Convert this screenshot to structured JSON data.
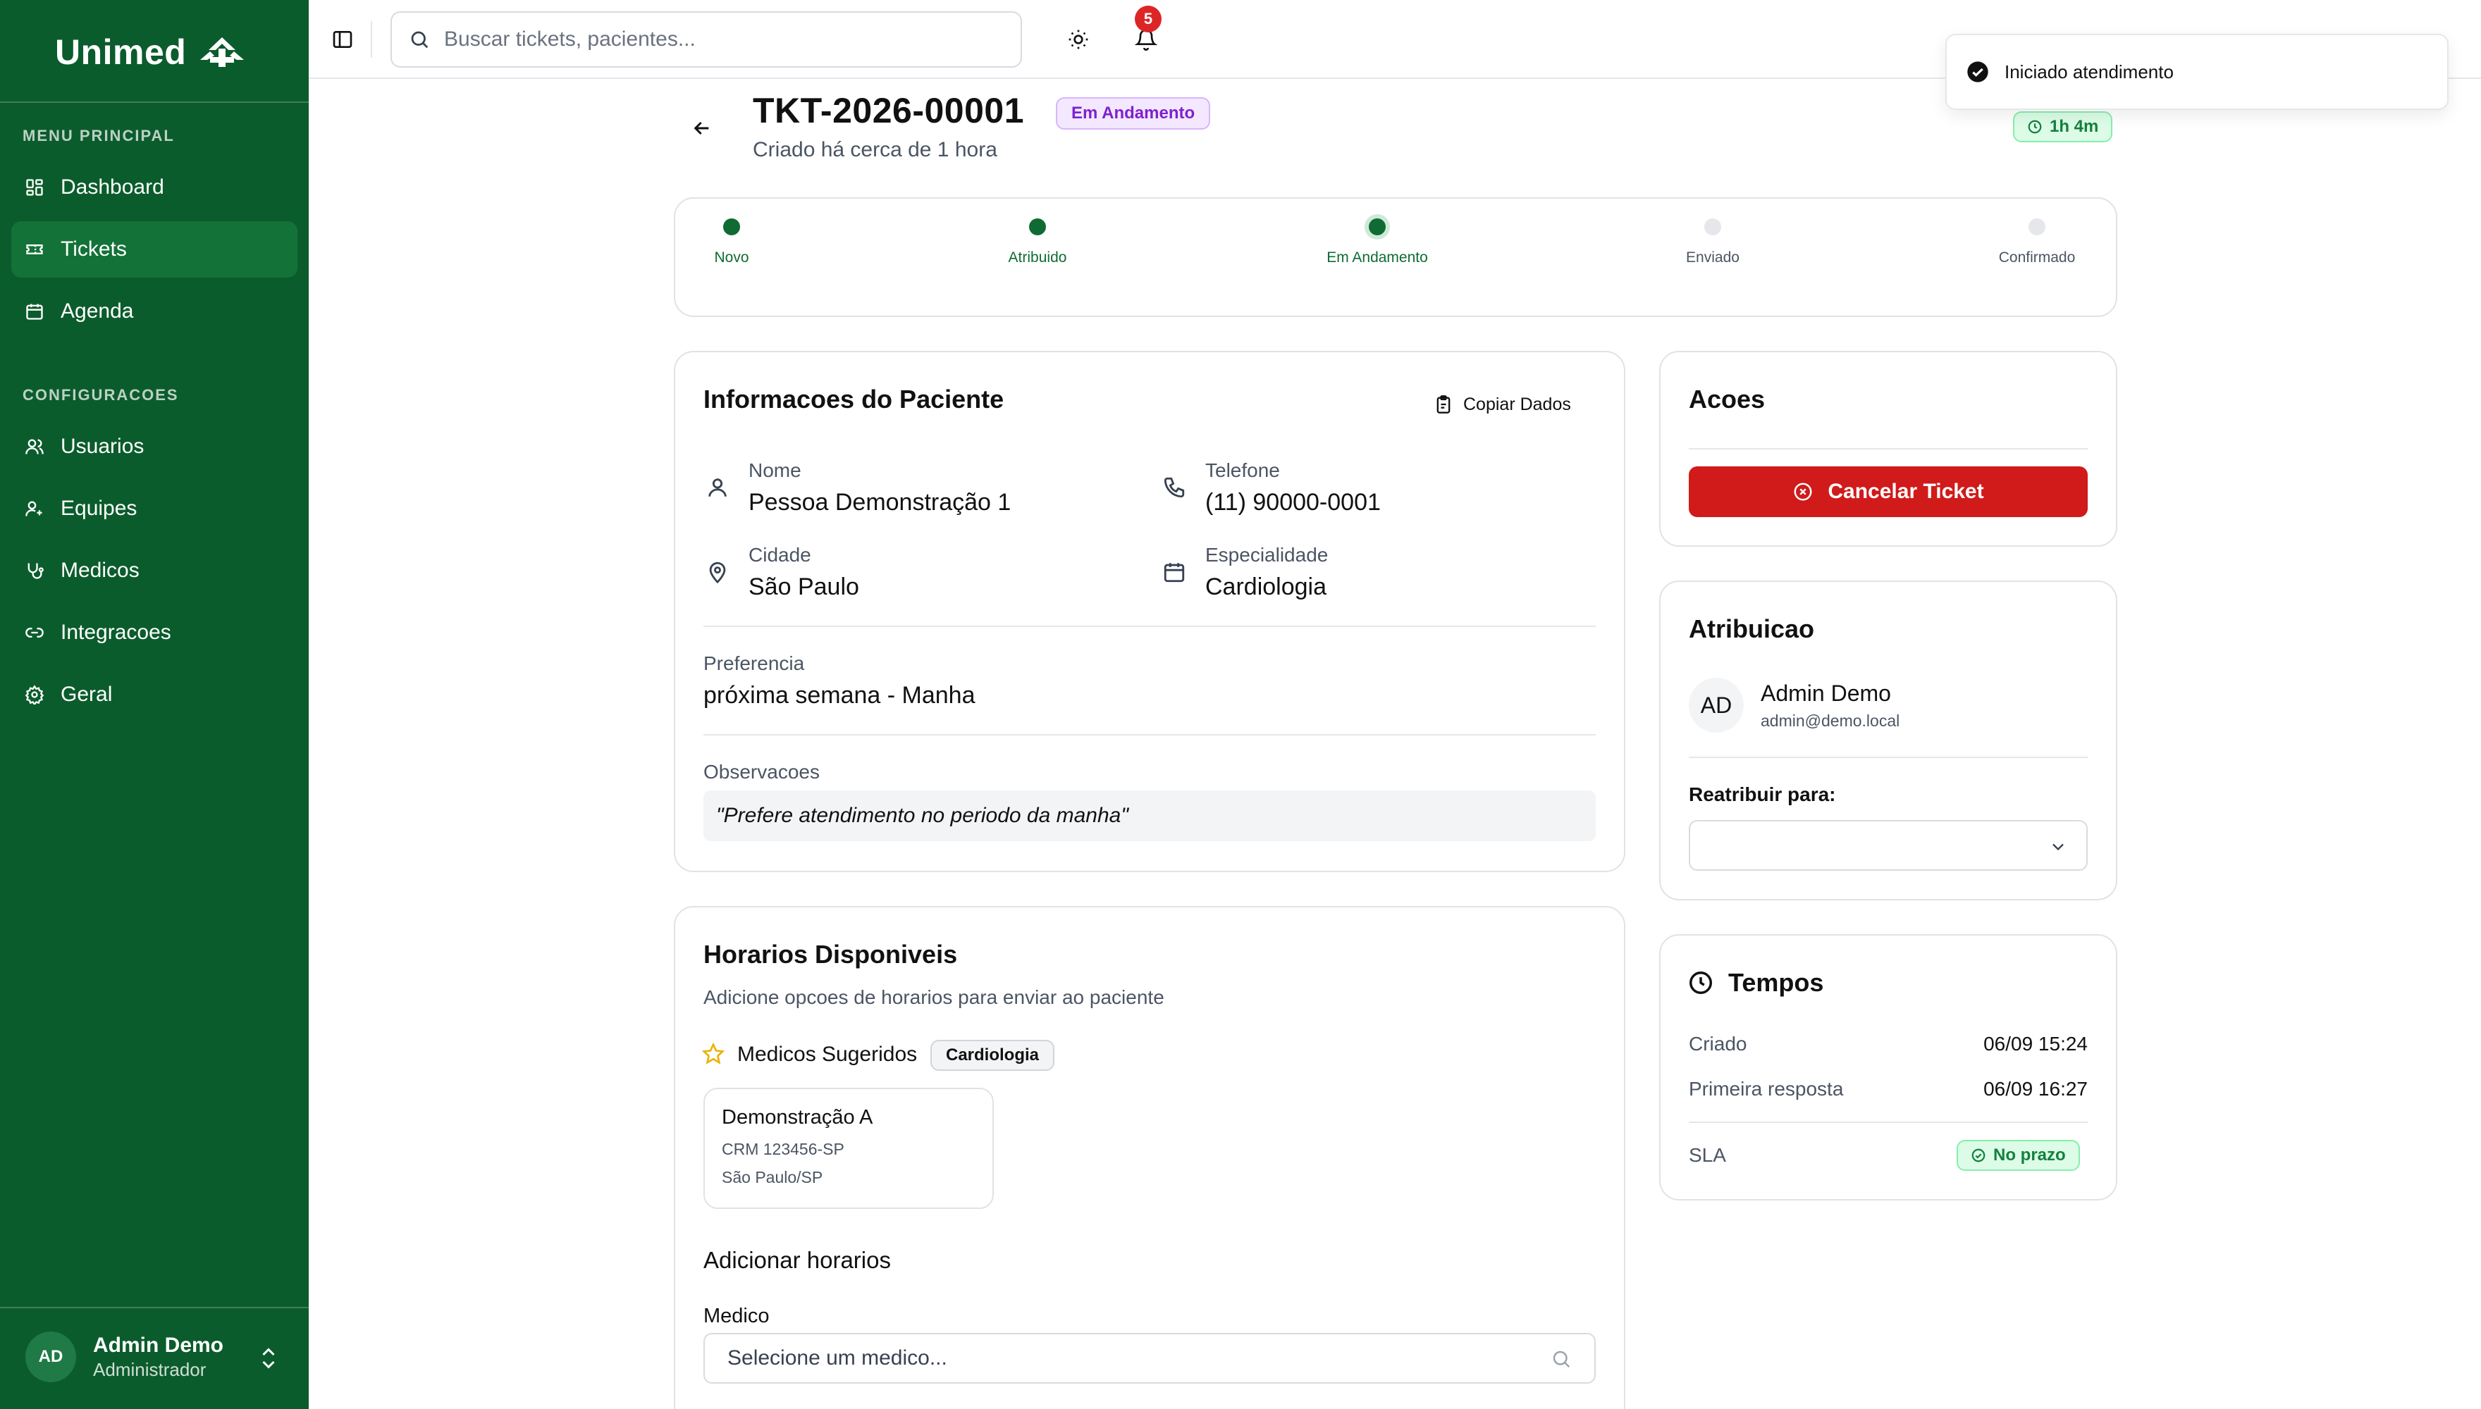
{
  "brand": {
    "name": "Unimed"
  },
  "sidebar": {
    "section_main": "MENU PRINCIPAL",
    "section_config": "CONFIGURACOES",
    "main_items": [
      {
        "label": "Dashboard",
        "icon": "dashboard-icon",
        "active": false
      },
      {
        "label": "Tickets",
        "icon": "ticket-icon",
        "active": true
      },
      {
        "label": "Agenda",
        "icon": "calendar-icon",
        "active": false
      }
    ],
    "config_items": [
      {
        "label": "Usuarios",
        "icon": "users-icon"
      },
      {
        "label": "Equipes",
        "icon": "team-icon"
      },
      {
        "label": "Medicos",
        "icon": "stethoscope-icon"
      },
      {
        "label": "Integracoes",
        "icon": "link-icon"
      },
      {
        "label": "Geral",
        "icon": "gear-icon"
      }
    ],
    "user": {
      "initials": "AD",
      "name": "Admin Demo",
      "role": "Administrador"
    }
  },
  "topbar": {
    "search_placeholder": "Buscar tickets, pacientes...",
    "notification_count": "5"
  },
  "toast": {
    "message": "Iniciado atendimento"
  },
  "ticket": {
    "id": "TKT-2026-00001",
    "status": "Em Andamento",
    "created": "Criado há cerca de 1 hora",
    "elapsed": "1h 4m"
  },
  "progress": {
    "steps": [
      {
        "label": "Novo",
        "state": "done"
      },
      {
        "label": "Atribuido",
        "state": "done"
      },
      {
        "label": "Em Andamento",
        "state": "current"
      },
      {
        "label": "Enviado",
        "state": "pending"
      },
      {
        "label": "Confirmado",
        "state": "pending"
      }
    ]
  },
  "patient": {
    "title": "Informacoes do Paciente",
    "copy_label": "Copiar Dados",
    "name_label": "Nome",
    "name": "Pessoa Demonstração 1",
    "phone_label": "Telefone",
    "phone": "(11) 90000-0001",
    "city_label": "Cidade",
    "city": "São Paulo",
    "specialty_label": "Especialidade",
    "specialty": "Cardiologia",
    "preference_label": "Preferencia",
    "preference": "próxima semana - Manha",
    "notes_label": "Observacoes",
    "notes": "\"Prefere atendimento no periodo da manha\""
  },
  "schedule": {
    "title": "Horarios Disponiveis",
    "subtitle": "Adicione opcoes de horarios para enviar ao paciente",
    "suggested_label": "Medicos Sugeridos",
    "suggested_specialty": "Cardiologia",
    "doctor": {
      "name": "Demonstração A",
      "crm": "CRM 123456-SP",
      "location": "São Paulo/SP"
    },
    "add_title": "Adicionar horarios",
    "doctor_field_label": "Medico",
    "doctor_placeholder": "Selecione um medico..."
  },
  "actions": {
    "title": "Acoes",
    "cancel_label": "Cancelar Ticket"
  },
  "assignment": {
    "title": "Atribuicao",
    "initials": "AD",
    "name": "Admin Demo",
    "email": "admin@demo.local",
    "reassign_label": "Reatribuir para:",
    "reassign_value": ""
  },
  "times": {
    "title": "Tempos",
    "created_label": "Criado",
    "created_value": "06/09 15:24",
    "first_response_label": "Primeira resposta",
    "first_response_value": "06/09 16:27",
    "sla_label": "SLA",
    "sla_status": "No prazo"
  },
  "colors": {
    "sidebar": "#0b5c2c",
    "accent_green": "#0f6b33",
    "danger": "#d11a1a",
    "status_purple": "#7e22ce",
    "badge_red": "#dc2626"
  }
}
